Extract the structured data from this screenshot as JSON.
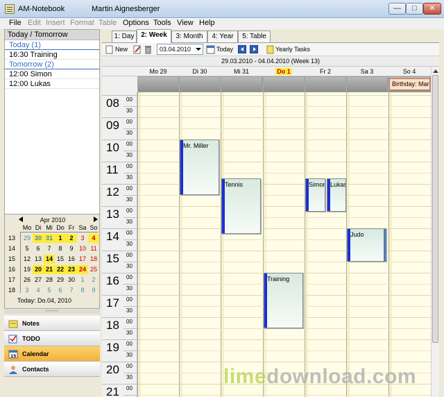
{
  "window": {
    "title": "AM-Notebook",
    "user": "Martin Aignesberger",
    "min_label": "—",
    "max_label": "□",
    "close_label": "✕"
  },
  "menu": [
    {
      "label": "File",
      "enabled": true
    },
    {
      "label": "Edit",
      "enabled": false
    },
    {
      "label": "Insert",
      "enabled": false
    },
    {
      "label": "Format",
      "enabled": false
    },
    {
      "label": "Table",
      "enabled": false
    },
    {
      "label": "Options",
      "enabled": true
    },
    {
      "label": "Tools",
      "enabled": true
    },
    {
      "label": "View",
      "enabled": true
    },
    {
      "label": "Help",
      "enabled": true
    }
  ],
  "today_panel": {
    "header": "Today / Tomorrow",
    "today_group": "Today (1)",
    "today_items": [
      "16:30 Training"
    ],
    "tomorrow_group": "Tomorrow (2)",
    "tomorrow_items": [
      "12:00 Simon",
      "12:00 Lukas"
    ]
  },
  "mini_calendar": {
    "month": "Apr 2010",
    "weekdays": [
      "Mo",
      "Di",
      "Mi",
      "Do",
      "Fr",
      "Sa",
      "So"
    ],
    "weeks": [
      {
        "wk": "13",
        "days": [
          "29",
          "30",
          "31",
          "1",
          "2",
          "3",
          "4"
        ]
      },
      {
        "wk": "14",
        "days": [
          "5",
          "6",
          "7",
          "8",
          "9",
          "10",
          "11"
        ]
      },
      {
        "wk": "15",
        "days": [
          "12",
          "13",
          "14",
          "15",
          "16",
          "17",
          "18"
        ]
      },
      {
        "wk": "16",
        "days": [
          "19",
          "20",
          "21",
          "22",
          "23",
          "24",
          "25"
        ]
      },
      {
        "wk": "17",
        "days": [
          "26",
          "27",
          "28",
          "29",
          "30",
          "1",
          "2"
        ]
      },
      {
        "wk": "18",
        "days": [
          "3",
          "4",
          "5",
          "6",
          "7",
          "8",
          "9"
        ]
      }
    ],
    "today_label": "Today:  Do.04, 2010",
    "highlight_color": "#ffeb3b"
  },
  "nav": [
    {
      "label": "Notes",
      "icon": "notes-icon",
      "active": false
    },
    {
      "label": "TODO",
      "icon": "todo-icon",
      "active": false
    },
    {
      "label": "Calendar",
      "icon": "calendar-icon",
      "active": true
    },
    {
      "label": "Contacts",
      "icon": "contacts-icon",
      "active": false
    }
  ],
  "tabs": [
    {
      "label": "1: Day",
      "active": false
    },
    {
      "label": "2: Week",
      "active": true
    },
    {
      "label": "3: Month",
      "active": false
    },
    {
      "label": "4: Year",
      "active": false
    },
    {
      "label": "5: Table",
      "active": false
    }
  ],
  "toolbar": {
    "new_label": "New",
    "date_value": "03.04.2010",
    "today_label": "Today",
    "yearly_label": "Yearly Tasks"
  },
  "week": {
    "range": "29.03.2010  -  04.04.2010   (Week 13)",
    "days": [
      "Mo 29",
      "Di 30",
      "Mi 31",
      "Do 1",
      "Fr 2",
      "Sa 3",
      "So 4"
    ],
    "today_index": 3,
    "hours": [
      "08",
      "09",
      "10",
      "11",
      "12",
      "13",
      "14",
      "15",
      "16",
      "17",
      "18",
      "19",
      "20",
      "21"
    ],
    "minutes": [
      "00",
      "30"
    ],
    "allday": [
      {
        "day": 6,
        "title": "Birthday: Mar"
      }
    ],
    "appointments": [
      {
        "title": "Mr. Miller",
        "day": 1,
        "start": 10.0,
        "end": 12.5
      },
      {
        "title": "Tennis",
        "day": 2,
        "start": 11.75,
        "end": 14.25
      },
      {
        "title": "Simon",
        "day": 4,
        "start": 11.75,
        "end": 13.25
      },
      {
        "title": "Lukas",
        "day": 4,
        "start": 11.75,
        "end": 13.25
      },
      {
        "title": "Judo",
        "day": 5,
        "start": 14.0,
        "end": 15.5
      },
      {
        "title": "Training",
        "day": 3,
        "start": 16.0,
        "end": 18.5
      }
    ],
    "colors": {
      "background": "#fffde7",
      "appointment_bar": "#1a2fd6",
      "today_highlight": "#ffeb3b"
    }
  },
  "watermark": {
    "lime": "lime",
    "rest": "download.com"
  }
}
